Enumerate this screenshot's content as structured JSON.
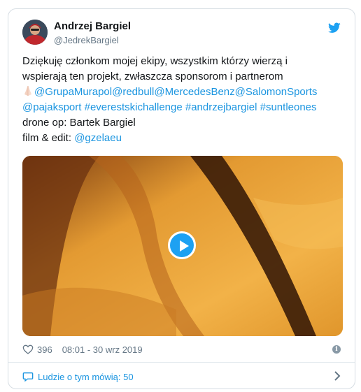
{
  "author": {
    "name": "Andrzej Bargiel",
    "handle": "@JedrekBargiel",
    "avatar_icon": "avatar-photo",
    "platform_icon": "twitter-bird-icon"
  },
  "tweet": {
    "line1": "Dziękuję członkom mojej ekipy, wszystkim którzy wierzą i",
    "line2": "wspierają ten projekt, zwłaszcza sponsorom i partnerom",
    "mentions_line3": [
      "@GrupaMurapol",
      "@redbull",
      "@MercedesBenz",
      "@SalomonSports"
    ],
    "line4_mention": "@pajaksport",
    "line4_hashtags": [
      "#everestskichallenge",
      "#andrzejbargiel",
      "#suntleones"
    ],
    "line5": "drone op: Bartek Bargiel",
    "line6_prefix": "film & edit: ",
    "line6_mention": "@gzelaeu",
    "emoji_icon": "folded-hands-icon"
  },
  "media": {
    "type": "video",
    "play_icon": "play-icon"
  },
  "stats": {
    "likes": "396",
    "timestamp": "08:01 - 30 wrz 2019"
  },
  "footer": {
    "conversation_label": "Ludzie o tym mówią: 50"
  },
  "colors": {
    "link": "#1b95e0",
    "accent": "#1da1f2",
    "muted": "#657786"
  }
}
